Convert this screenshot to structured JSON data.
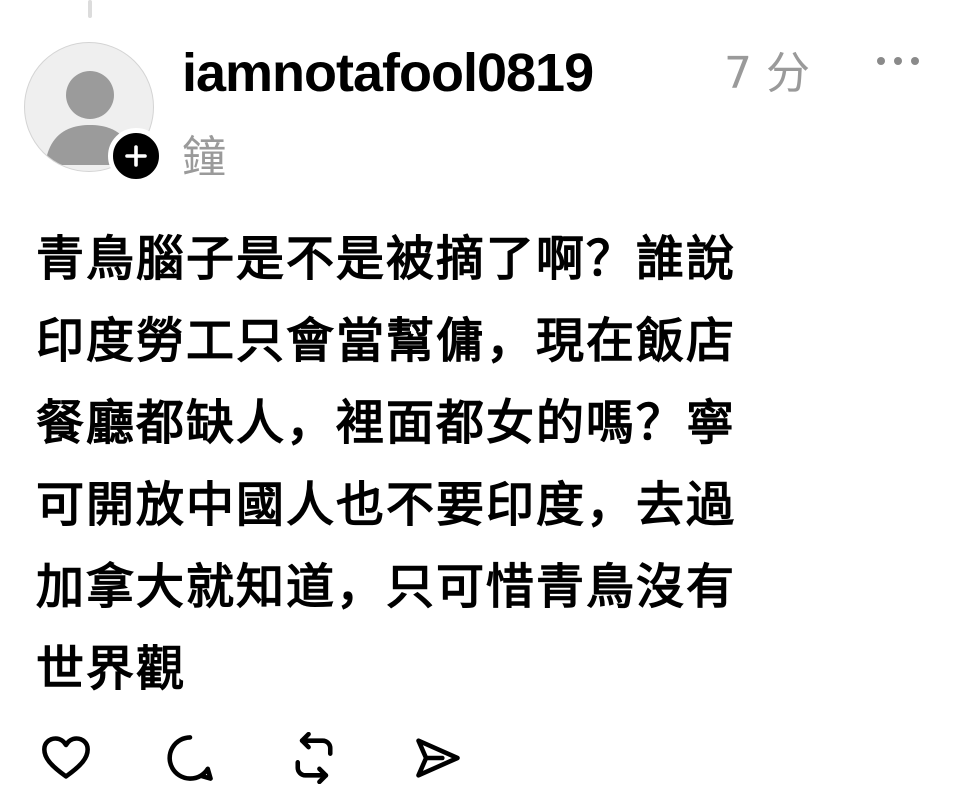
{
  "post": {
    "username": "iamnotafool0819",
    "time_line1": "7 分",
    "time_line2": "鐘",
    "text": "青鳥腦子是不是被摘了啊？誰說\n印度勞工只會當幫傭，現在飯店\n餐廳都缺人，裡面都女的嗎？寧\n可開放中國人也不要印度，去過\n加拿大就知道，只可惜青鳥沒有\n世界觀"
  },
  "icons": {
    "avatar": "default-avatar-icon",
    "follow": "plus-icon",
    "more": "more-dots-icon",
    "like": "heart-icon",
    "reply": "comment-bubble-icon",
    "repost": "repost-icon",
    "share": "send-icon"
  },
  "colors": {
    "text": "#000000",
    "muted": "#9a9a9a",
    "avatar_bg": "#efefef",
    "avatar_figure": "#9b9b9b",
    "badge": "#000000"
  }
}
